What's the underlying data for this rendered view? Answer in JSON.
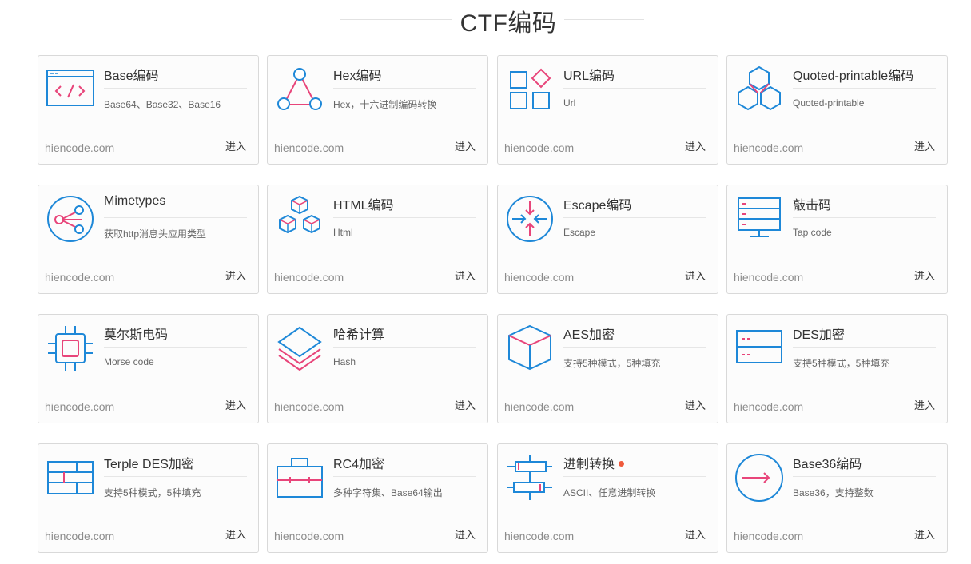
{
  "header": {
    "title": "CTF编码"
  },
  "cards": [
    {
      "name": "Base编码",
      "desc": "Base64、Base32、Base16",
      "site": "hiencode.com",
      "enter": "进入",
      "icon": "code-window-icon"
    },
    {
      "name": "Hex编码",
      "desc": "Hex，十六进制编码转换",
      "site": "hiencode.com",
      "enter": "进入",
      "icon": "triangle-nodes-icon"
    },
    {
      "name": "URL编码",
      "desc": "Url",
      "site": "hiencode.com",
      "enter": "进入",
      "icon": "blocks-diamond-icon"
    },
    {
      "name": "Quoted-printable编码",
      "desc": "Quoted-printable",
      "site": "hiencode.com",
      "enter": "进入",
      "icon": "hexagons-icon"
    },
    {
      "name": "Mimetypes",
      "desc": "获取http消息头应用类型",
      "site": "hiencode.com",
      "enter": "进入",
      "icon": "share-icon"
    },
    {
      "name": "HTML编码",
      "desc": "Html",
      "site": "hiencode.com",
      "enter": "进入",
      "icon": "cubes-icon"
    },
    {
      "name": "Escape编码",
      "desc": "Escape",
      "site": "hiencode.com",
      "enter": "进入",
      "icon": "arrows-converge-icon"
    },
    {
      "name": "敲击码",
      "desc": "Tap code",
      "site": "hiencode.com",
      "enter": "进入",
      "icon": "server-monitor-icon"
    },
    {
      "name": "莫尔斯电码",
      "desc": "Morse code",
      "site": "hiencode.com",
      "enter": "进入",
      "icon": "chip-icon"
    },
    {
      "name": "哈希计算",
      "desc": "Hash",
      "site": "hiencode.com",
      "enter": "进入",
      "icon": "layers-icon"
    },
    {
      "name": "AES加密",
      "desc": "支持5种模式，5种填充",
      "site": "hiencode.com",
      "enter": "进入",
      "icon": "cube-icon"
    },
    {
      "name": "DES加密",
      "desc": "支持5种模式，5种填充",
      "site": "hiencode.com",
      "enter": "进入",
      "icon": "panel-icon"
    },
    {
      "name": "Terple DES加密",
      "desc": "支持5种模式，5种填充",
      "site": "hiencode.com",
      "enter": "进入",
      "icon": "brick-wall-icon"
    },
    {
      "name": "RC4加密",
      "desc": "多种字符集、Base64输出",
      "site": "hiencode.com",
      "enter": "进入",
      "icon": "briefcase-icon"
    },
    {
      "name": "进制转换",
      "desc": "ASCII、任意进制转换",
      "site": "hiencode.com",
      "enter": "进入",
      "icon": "sliders-icon",
      "dot": true
    },
    {
      "name": "Base36编码",
      "desc": "Base36，支持整数",
      "site": "hiencode.com",
      "enter": "进入",
      "icon": "circle-arrow-icon"
    }
  ],
  "colors": {
    "blue": "#1e88d8",
    "pink": "#e8457a",
    "dot": "#ef5a3c"
  }
}
